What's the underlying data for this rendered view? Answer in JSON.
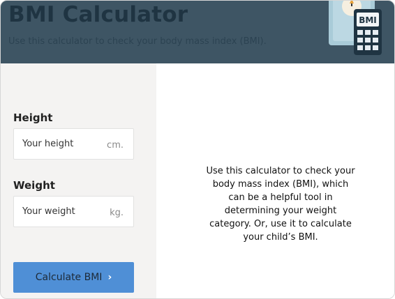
{
  "header": {
    "title": "BMI Calculator",
    "subtitle": "Use this calculator to check your body mass index (BMI).",
    "illustration_icon": "bmi-scale-calculator-icon",
    "calculator_label": "BMI"
  },
  "form": {
    "height": {
      "label": "Height",
      "placeholder": "Your height",
      "unit": "cm."
    },
    "weight": {
      "label": "Weight",
      "placeholder": "Your weight",
      "unit": "kg."
    },
    "submit": {
      "label": "Calculate BMI",
      "icon": "chevron-right-icon"
    }
  },
  "info": {
    "text": "Use this calculator to check your body mass index (BMI), which can be a helpful tool in determining your weight category. Or, use it to calculate your child’s BMI."
  },
  "colors": {
    "header_bg": "#3e5564",
    "left_panel_bg": "#f4f3f2",
    "button_bg": "#4f8fd6"
  }
}
